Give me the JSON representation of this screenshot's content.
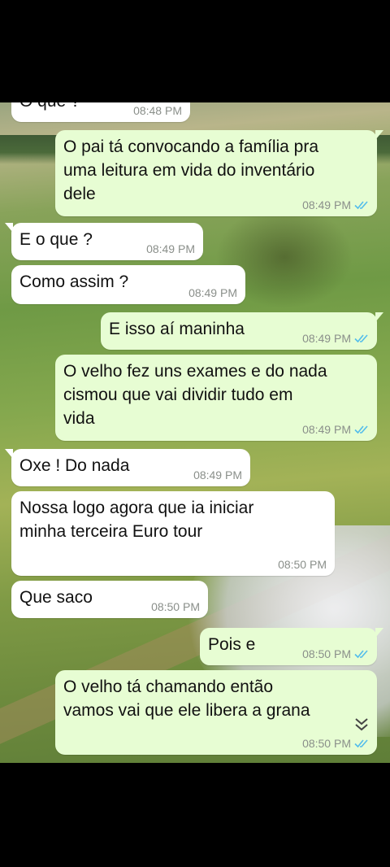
{
  "colors": {
    "incoming_bubble": "#ffffff",
    "outgoing_bubble": "#e7fdd3",
    "read_ticks": "#53bdeb",
    "timestamp": "#8a8f8a"
  },
  "messages": [
    {
      "direction": "in",
      "text": "O que ?",
      "time": "08:48 PM"
    },
    {
      "direction": "out",
      "text": "O pai tá convocando a família pra\numa leitura em vida do inventário\ndele",
      "time": "08:49 PM",
      "ticks": "read"
    },
    {
      "direction": "in",
      "text": "E o que ?",
      "time": "08:49 PM"
    },
    {
      "direction": "in",
      "text": "Como assim ?",
      "time": "08:49 PM"
    },
    {
      "direction": "out",
      "text": "E isso aí maninha",
      "time": "08:49 PM",
      "ticks": "read"
    },
    {
      "direction": "out",
      "text": "O velho fez uns exames e do nada\ncismou que vai dividir tudo em\nvida",
      "time": "08:49 PM",
      "ticks": "read"
    },
    {
      "direction": "in",
      "text": "Oxe ! Do nada",
      "time": "08:49 PM"
    },
    {
      "direction": "in",
      "text": "Nossa logo agora que ia iniciar\nminha terceira Euro tour",
      "time": "08:50 PM"
    },
    {
      "direction": "in",
      "text": "Que saco",
      "time": "08:50 PM"
    },
    {
      "direction": "out",
      "text": "Pois e",
      "time": "08:50 PM",
      "ticks": "read"
    },
    {
      "direction": "out",
      "text": "O velho tá chamando então\nvamos vai que ele libera a grana",
      "time": "08:50 PM",
      "ticks": "read"
    }
  ],
  "icons": {
    "read_receipt": "double-check-icon",
    "scroll_down": "double-chevron-down-icon"
  }
}
